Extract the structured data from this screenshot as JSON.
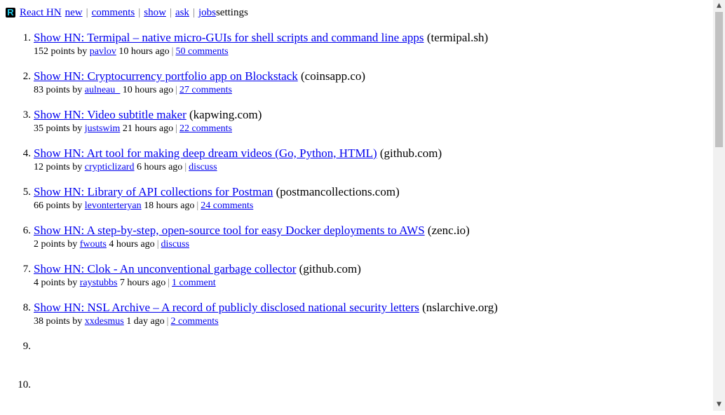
{
  "header": {
    "logo_letter": "R",
    "brand": "React HN",
    "nav": [
      "new",
      "comments",
      "show",
      "ask",
      "jobs"
    ],
    "settings": "settings"
  },
  "stories": [
    {
      "rank": "1.",
      "title": "Show HN: Termipal – native micro-GUIs for shell scripts and command line apps",
      "domain": "(termipal.sh)",
      "points": "152 points by",
      "user": "pavlov",
      "age": "10 hours ago",
      "comments": "50 comments"
    },
    {
      "rank": "2.",
      "title": "Show HN: Cryptocurrency portfolio app on Blockstack",
      "domain": "(coinsapp.co)",
      "points": "83 points by",
      "user": "aulneau_",
      "age": "10 hours ago",
      "comments": "27 comments"
    },
    {
      "rank": "3.",
      "title": "Show HN: Video subtitle maker",
      "domain": "(kapwing.com)",
      "points": "35 points by",
      "user": "justswim",
      "age": "21 hours ago",
      "comments": "22 comments"
    },
    {
      "rank": "4.",
      "title": "Show HN: Art tool for making deep dream videos (Go, Python, HTML)",
      "domain": "(github.com)",
      "points": "12 points by",
      "user": "crypticlizard",
      "age": "6 hours ago",
      "comments": "discuss"
    },
    {
      "rank": "5.",
      "title": "Show HN: Library of API collections for Postman",
      "domain": "(postmancollections.com)",
      "points": "66 points by",
      "user": "levonterteryan",
      "age": "18 hours ago",
      "comments": "24 comments"
    },
    {
      "rank": "6.",
      "title": "Show HN: A step-by-step, open-source tool for easy Docker deployments to AWS",
      "domain": "(zenc.io)",
      "points": "2 points by",
      "user": "fwouts",
      "age": "4 hours ago",
      "comments": "discuss"
    },
    {
      "rank": "7.",
      "title": "Show HN: Clok - An unconventional garbage collector",
      "domain": "(github.com)",
      "points": "4 points by",
      "user": "raystubbs",
      "age": "7 hours ago",
      "comments": "1 comment"
    },
    {
      "rank": "8.",
      "title": "Show HN: NSL Archive – A record of publicly disclosed national security letters",
      "domain": "(nslarchive.org)",
      "points": "38 points by",
      "user": "xxdesmus",
      "age": "1 day ago",
      "comments": "2 comments"
    },
    {
      "rank": "9."
    },
    {
      "rank": "10."
    }
  ],
  "meta_separator": "|",
  "scrollbar": {
    "up_icon": "triangle-up",
    "down_icon": "triangle-down",
    "position": 0.0
  }
}
